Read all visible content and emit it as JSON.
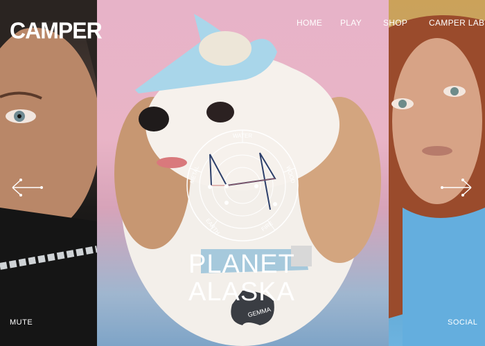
{
  "brand": {
    "logo": "CAMPER"
  },
  "nav": {
    "items": [
      "HOME",
      "PLAY",
      "SHOP",
      "CAMPER LAB"
    ]
  },
  "hero": {
    "line1": "PLANET",
    "line2": "ALASKA"
  },
  "compass": {
    "labels": [
      "WATER",
      "WOOD",
      "FIRE",
      "EARTH",
      "METAL"
    ]
  },
  "tag": {
    "text": "GEMMA"
  },
  "footer": {
    "left": "MUTE",
    "right": "SOCIAL"
  },
  "icons": {
    "prev": "arrow-left-icon",
    "next": "arrow-right-icon"
  }
}
